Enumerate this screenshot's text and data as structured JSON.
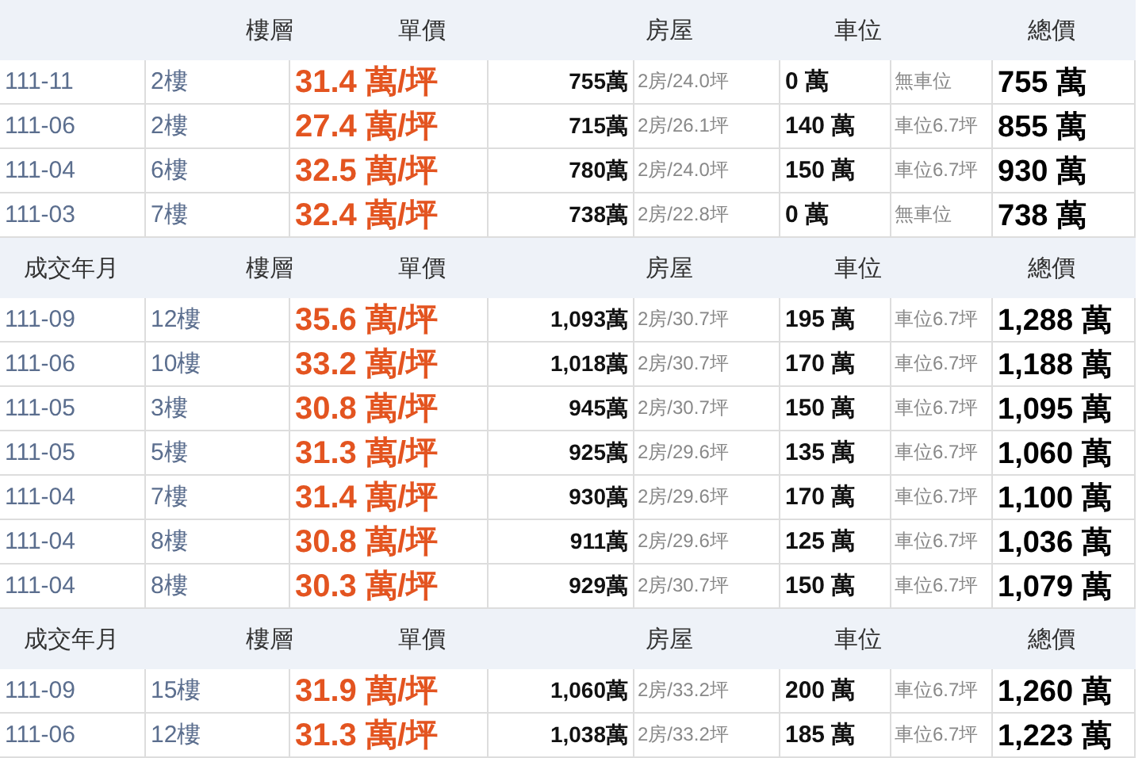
{
  "tables": [
    {
      "header": {
        "floor": "樓層",
        "unit_price": "單價",
        "house": "房屋",
        "parking": "車位",
        "total": "總價"
      },
      "rows": [
        {
          "date": "111-11",
          "floor": "2樓",
          "unit_price": "31.4 萬/坪",
          "house_price": "755萬",
          "house_detail": "2房/24.0坪",
          "parking_price": "0 萬",
          "parking_detail": "無車位",
          "total": "755 萬"
        },
        {
          "date": "111-06",
          "floor": "2樓",
          "unit_price": "27.4 萬/坪",
          "house_price": "715萬",
          "house_detail": "2房/26.1坪",
          "parking_price": "140 萬",
          "parking_detail": "車位6.7坪",
          "total": "855 萬"
        },
        {
          "date": "111-04",
          "floor": "6樓",
          "unit_price": "32.5 萬/坪",
          "house_price": "780萬",
          "house_detail": "2房/24.0坪",
          "parking_price": "150 萬",
          "parking_detail": "車位6.7坪",
          "total": "930 萬"
        },
        {
          "date": "111-03",
          "floor": "7樓",
          "unit_price": "32.4 萬/坪",
          "house_price": "738萬",
          "house_detail": "2房/22.8坪",
          "parking_price": "0 萬",
          "parking_detail": "無車位",
          "total": "738 萬"
        }
      ]
    },
    {
      "header": {
        "date": "成交年月",
        "floor": "樓層",
        "unit_price": "單價",
        "house": "房屋",
        "parking": "車位",
        "total": "總價"
      },
      "rows": [
        {
          "date": "111-09",
          "floor": "12樓",
          "unit_price": "35.6 萬/坪",
          "house_price": "1,093萬",
          "house_detail": "2房/30.7坪",
          "parking_price": "195 萬",
          "parking_detail": "車位6.7坪",
          "total": "1,288 萬"
        },
        {
          "date": "111-06",
          "floor": "10樓",
          "unit_price": "33.2 萬/坪",
          "house_price": "1,018萬",
          "house_detail": "2房/30.7坪",
          "parking_price": "170 萬",
          "parking_detail": "車位6.7坪",
          "total": "1,188 萬"
        },
        {
          "date": "111-05",
          "floor": "3樓",
          "unit_price": "30.8 萬/坪",
          "house_price": "945萬",
          "house_detail": "2房/30.7坪",
          "parking_price": "150 萬",
          "parking_detail": "車位6.7坪",
          "total": "1,095 萬"
        },
        {
          "date": "111-05",
          "floor": "5樓",
          "unit_price": "31.3 萬/坪",
          "house_price": "925萬",
          "house_detail": "2房/29.6坪",
          "parking_price": "135 萬",
          "parking_detail": "車位6.7坪",
          "total": "1,060 萬"
        },
        {
          "date": "111-04",
          "floor": "7樓",
          "unit_price": "31.4 萬/坪",
          "house_price": "930萬",
          "house_detail": "2房/29.6坪",
          "parking_price": "170 萬",
          "parking_detail": "車位6.7坪",
          "total": "1,100 萬"
        },
        {
          "date": "111-04",
          "floor": "8樓",
          "unit_price": "30.8 萬/坪",
          "house_price": "911萬",
          "house_detail": "2房/29.6坪",
          "parking_price": "125 萬",
          "parking_detail": "車位6.7坪",
          "total": "1,036 萬"
        },
        {
          "date": "111-04",
          "floor": "8樓",
          "unit_price": "30.3 萬/坪",
          "house_price": "929萬",
          "house_detail": "2房/30.7坪",
          "parking_price": "150 萬",
          "parking_detail": "車位6.7坪",
          "total": "1,079 萬"
        }
      ]
    },
    {
      "header": {
        "date": "成交年月",
        "floor": "樓層",
        "unit_price": "單價",
        "house": "房屋",
        "parking": "車位",
        "total": "總價"
      },
      "rows": [
        {
          "date": "111-09",
          "floor": "15樓",
          "unit_price": "31.9 萬/坪",
          "house_price": "1,060萬",
          "house_detail": "2房/33.2坪",
          "parking_price": "200 萬",
          "parking_detail": "車位6.7坪",
          "total": "1,260 萬"
        },
        {
          "date": "111-06",
          "floor": "12樓",
          "unit_price": "31.3 萬/坪",
          "house_price": "1,038萬",
          "house_detail": "2房/33.2坪",
          "parking_price": "185 萬",
          "parking_detail": "車位6.7坪",
          "total": "1,223 萬"
        }
      ]
    }
  ]
}
